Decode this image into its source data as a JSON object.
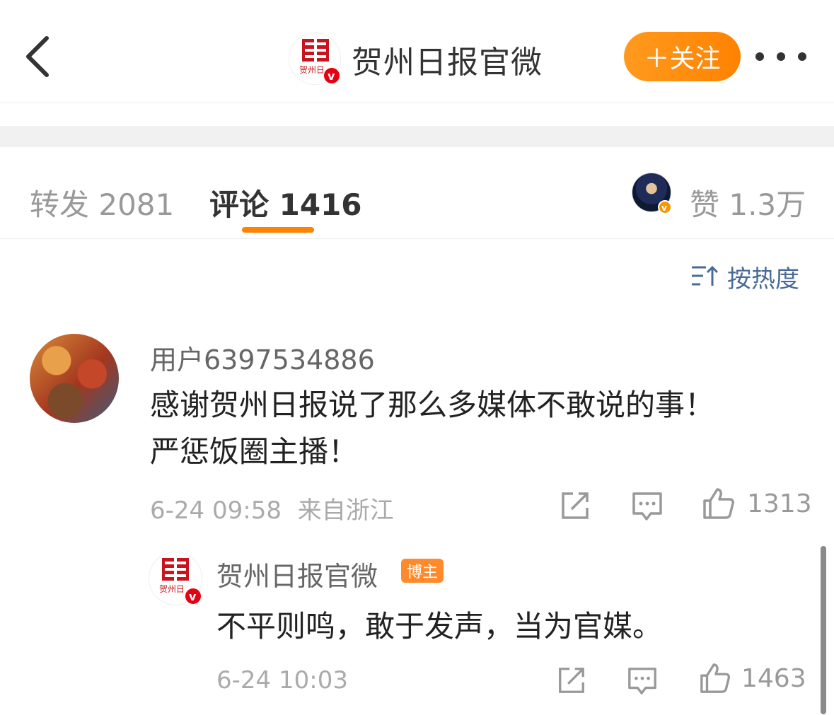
{
  "nav": {
    "title": "贺州日报官微",
    "follow_label": "＋关注",
    "avatar_logo_text": "贺州日",
    "accent": "#ff8200",
    "verified_color": "#e60012"
  },
  "tabs": {
    "repost": "转发 2081",
    "comment": "评论 1416",
    "like": "赞 1.3万"
  },
  "sort": {
    "label": "按热度",
    "color": "#4a6b95"
  },
  "comment": {
    "user": "用户6397534886",
    "text_line1": "感谢贺州日报说了那么多媒体不敢说的事！",
    "text_line2": "严惩饭圈主播！",
    "time": "6-24 09:58",
    "location": "来自浙江",
    "likes": "1313",
    "reply": {
      "user": "贺州日报官微",
      "badge": "博主",
      "text": "不平则鸣，敢于发声，当为官媒。",
      "time": "6-24 10:03",
      "likes": "1463"
    }
  }
}
